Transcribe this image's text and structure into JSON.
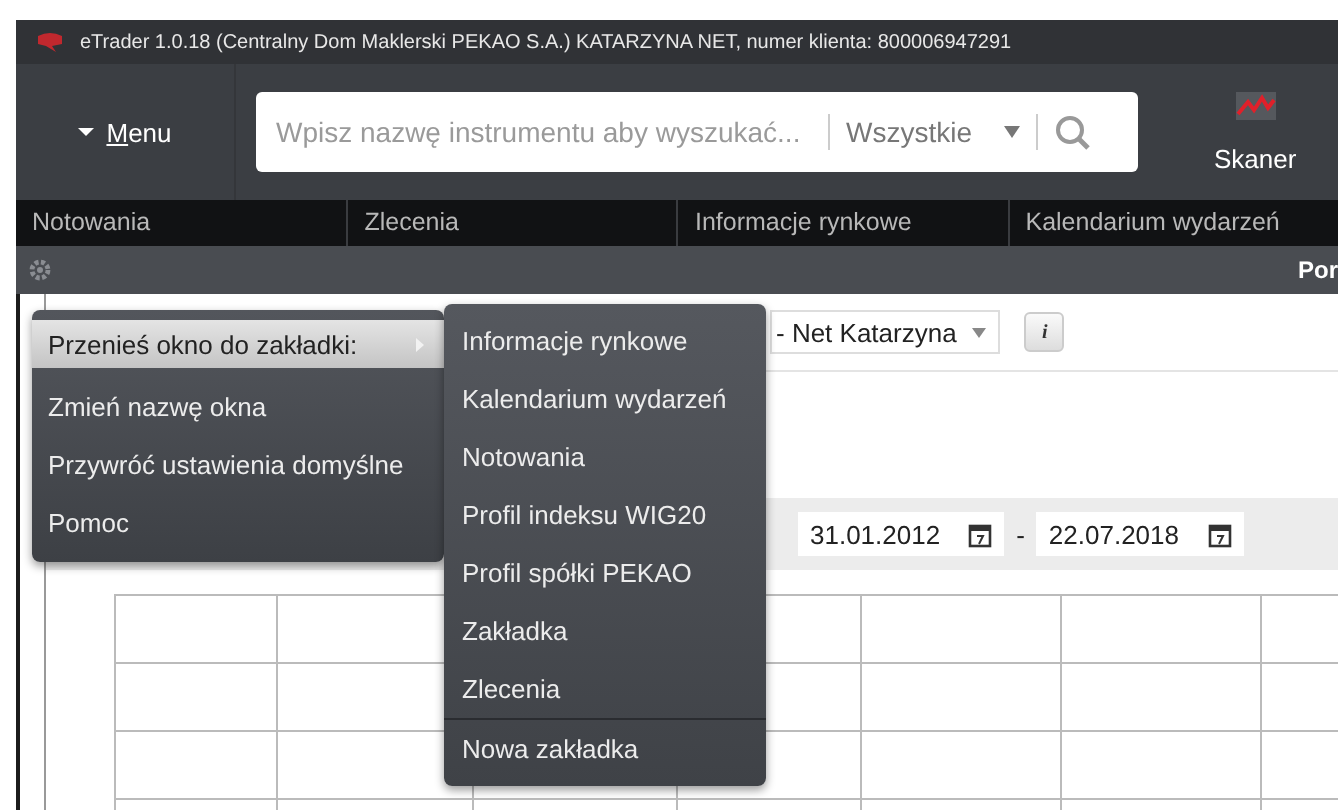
{
  "window": {
    "title": "eTrader 1.0.18 (Centralny Dom Maklerski PEKAO S.A.) KATARZYNA NET, numer klienta: 800006947291"
  },
  "header": {
    "menu_label": "Menu",
    "search": {
      "placeholder": "Wpisz nazwę instrumentu aby wyszukać..."
    },
    "filter": "Wszystkie",
    "scanner_label": "Skaner"
  },
  "tabs": [
    {
      "label": "Notowania",
      "selected": false
    },
    {
      "label": "Zlecenia",
      "selected": false
    },
    {
      "label": "Informacje rynkowe",
      "selected": false
    },
    {
      "label": "Kalendarium wydarzeń",
      "selected": false
    }
  ],
  "panel": {
    "title": "Por",
    "account": "- Net Katarzyna",
    "info_button": "i",
    "date_from": "31.01.2012",
    "date_separator": "-",
    "date_to": "22.07.2018"
  },
  "context_menu": [
    {
      "label": "Przenieś okno do zakładki:",
      "selected": true,
      "has_submenu": true
    },
    {
      "label": "Zmień nazwę okna",
      "selected": false,
      "has_submenu": false
    },
    {
      "label": "Przywróć ustawienia domyślne",
      "selected": false,
      "has_submenu": false
    },
    {
      "label": "Pomoc",
      "selected": false,
      "has_submenu": false
    }
  ],
  "submenu": [
    {
      "label": "Informacje rynkowe",
      "separator_before": false
    },
    {
      "label": "Kalendarium wydarzeń",
      "separator_before": false
    },
    {
      "label": "Notowania",
      "separator_before": false
    },
    {
      "label": "Profil indeksu WIG20",
      "separator_before": false
    },
    {
      "label": "Profil spółki PEKAO",
      "separator_before": false
    },
    {
      "label": "Zakładka",
      "separator_before": false
    },
    {
      "label": "Zlecenia",
      "separator_before": false
    },
    {
      "label": "Nowa zakładka",
      "separator_before": true
    }
  ]
}
